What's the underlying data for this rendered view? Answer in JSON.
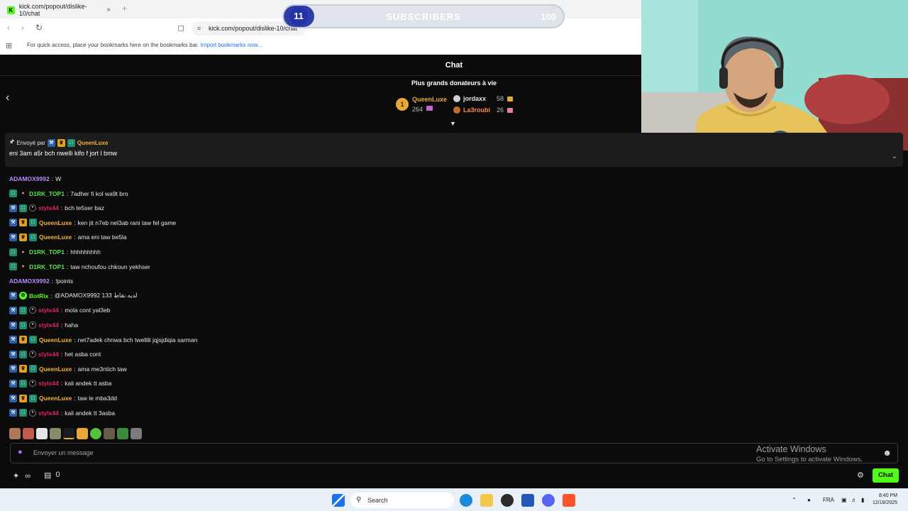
{
  "browser": {
    "tab_title": "kick.com/popout/dislike-10/chat",
    "tab_close": "×",
    "new_tab": "+",
    "url": "kick.com/popout/dislike-10/chat",
    "bookmarks_text": "For quick access, place your bookmarks here on the bookmarks bar.",
    "bookmarks_link": "Import bookmarks now..."
  },
  "sub_goal": {
    "current": "11",
    "label": "SUBSCRIBERS",
    "target": "100",
    "progress": 0.11
  },
  "chat": {
    "header_title": "Chat",
    "donors_heading": "Plus grands donateurs à vie",
    "top_donors": [
      {
        "rank": "1",
        "name": "QueenLuxe",
        "amount": "264",
        "color": "#e8a838"
      },
      {
        "rank": "2",
        "name": "jordaxx",
        "amount": "58",
        "color": "#e5e5e5"
      },
      {
        "rank": "3",
        "name": "La3roubi",
        "amount": "26",
        "color": "#ff8a3d"
      }
    ],
    "pinned": {
      "sent_by": "Envoyé par",
      "user": "QueenLuxe",
      "text": "eni 3am a5r bch nwelli kifo f jort l bmw"
    },
    "messages": [
      {
        "user": "ADAMOX9992",
        "text": "W",
        "color": "#b68bff",
        "badges": []
      },
      {
        "user": "D1RK_TOP1",
        "text": "7adher fi kol wa9t bro",
        "color": "#57e34b",
        "badges": [
          "sub",
          "fire"
        ]
      },
      {
        "user": "stylx44",
        "text": "bch te5ser baz",
        "color": "#e0245e",
        "badges": [
          "mod",
          "sub",
          "og"
        ]
      },
      {
        "user": "QueenLuxe",
        "text": "ken jit n7eb nel3ab rani taw fel game",
        "color": "#f2b33d",
        "badges": [
          "mod",
          "vip",
          "sub"
        ]
      },
      {
        "user": "QueenLuxe",
        "text": "ama eni taw be5la",
        "color": "#f2b33d",
        "badges": [
          "mod",
          "vip",
          "sub"
        ]
      },
      {
        "user": "D1RK_TOP1",
        "text": "hhhhhhhhh",
        "color": "#57e34b",
        "badges": [
          "sub",
          "fire"
        ]
      },
      {
        "user": "D1RK_TOP1",
        "text": "taw nchoufou chkoun yekhser",
        "color": "#57e34b",
        "badges": [
          "sub",
          "fire"
        ]
      },
      {
        "user": "ADAMOX9992",
        "text": "!points",
        "color": "#b68bff",
        "badges": []
      },
      {
        "user": "BotRix",
        "text": "@ADAMOX9992 133 لديه نقاط",
        "color": "#53fc18",
        "badges": [
          "mod",
          "bot"
        ]
      },
      {
        "user": "stylx44",
        "text": "mola cont yal3eb",
        "color": "#e0245e",
        "badges": [
          "mod",
          "sub",
          "og"
        ]
      },
      {
        "user": "stylx44",
        "text": "haha",
        "color": "#e0245e",
        "badges": [
          "mod",
          "sub",
          "og"
        ]
      },
      {
        "user": "QueenLuxe",
        "text": "net7adek chnwa bch twellili jqjsjdiqia sarman",
        "color": "#f2b33d",
        "badges": [
          "mod",
          "vip",
          "sub"
        ]
      },
      {
        "user": "stylx44",
        "text": "het asba cont",
        "color": "#e0245e",
        "badges": [
          "mod",
          "sub",
          "og"
        ]
      },
      {
        "user": "QueenLuxe",
        "text": "ama me3ntich taw",
        "color": "#f2b33d",
        "badges": [
          "mod",
          "vip",
          "sub"
        ]
      },
      {
        "user": "stylx44",
        "text": "kali andek tt asba",
        "color": "#e0245e",
        "badges": [
          "mod",
          "sub",
          "og"
        ]
      },
      {
        "user": "QueenLuxe",
        "text": "taw le mba3dd",
        "color": "#f2b33d",
        "badges": [
          "mod",
          "vip",
          "sub"
        ]
      },
      {
        "user": "stylx44",
        "text": "kali andek tt 3asba",
        "color": "#e0245e",
        "badges": [
          "mod",
          "sub",
          "og"
        ]
      }
    ],
    "input_placeholder": "Envoyer un message",
    "points": "0",
    "chat_button": "Chat"
  },
  "watermark": {
    "line1": "Activate Windows",
    "line2": "Go to Settings to activate Windows."
  },
  "taskbar": {
    "search_label": "Search",
    "language": "FRA",
    "time": "8:40 PM",
    "date": "12/18/2025"
  }
}
